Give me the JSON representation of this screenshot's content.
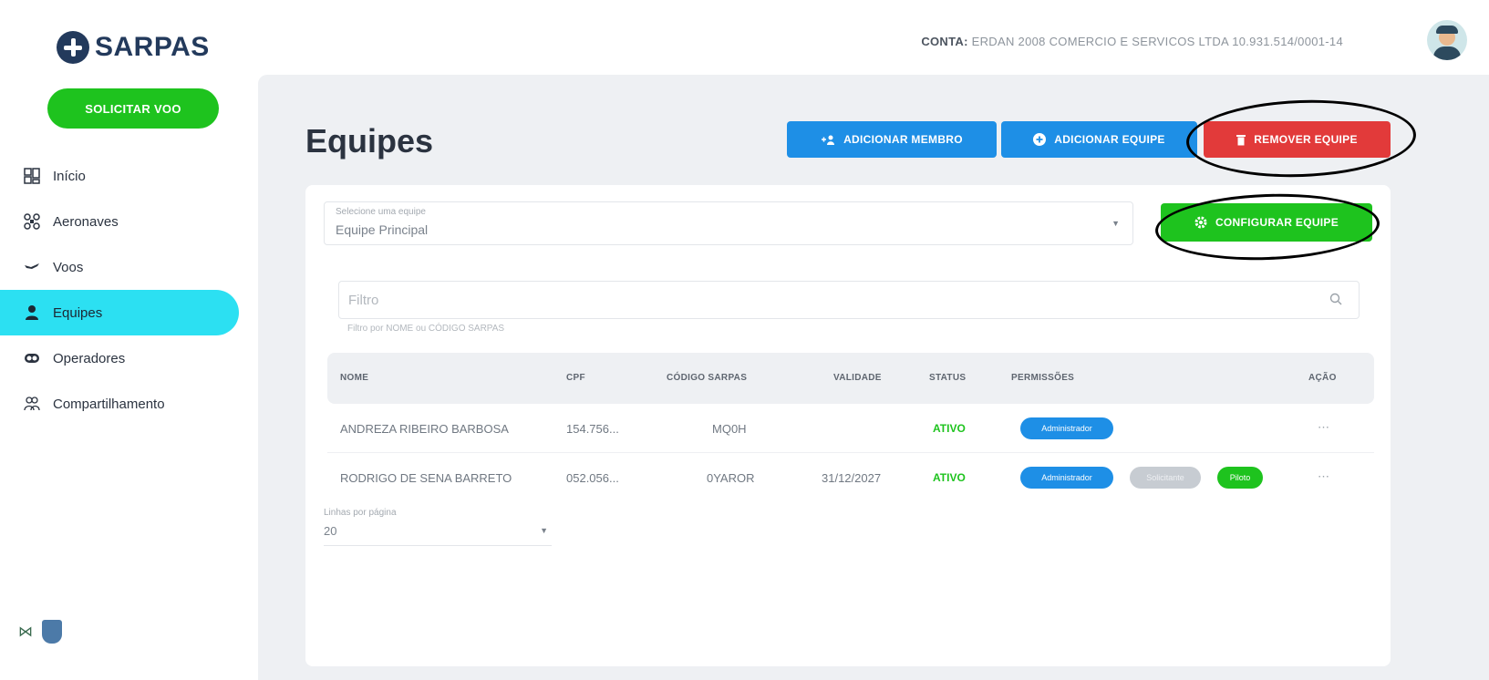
{
  "brand": {
    "name": "SARPAS"
  },
  "sidebar": {
    "cta": "SOLICITAR VOO",
    "items": [
      {
        "label": "Início",
        "icon": "dashboard-icon"
      },
      {
        "label": "Aeronaves",
        "icon": "drone-icon"
      },
      {
        "label": "Voos",
        "icon": "plane-icon"
      },
      {
        "label": "Equipes",
        "icon": "person-icon",
        "active": true
      },
      {
        "label": "Operadores",
        "icon": "id-card-icon"
      },
      {
        "label": "Compartilhamento",
        "icon": "users-icon"
      }
    ]
  },
  "header": {
    "account_label": "CONTA:",
    "account_value": "ERDAN 2008 COMERCIO E SERVICOS LTDA 10.931.514/0001-14"
  },
  "main": {
    "title": "Equipes",
    "buttons": {
      "add_member": "ADICIONAR MEMBRO",
      "add_team": "ADICIONAR EQUIPE",
      "remove_team": "REMOVER EQUIPE",
      "configure_team": "CONFIGURAR EQUIPE"
    },
    "team_select": {
      "label": "Selecione uma equipe",
      "value": "Equipe Principal"
    },
    "filter": {
      "placeholder": "Filtro",
      "helper": "Filtro por NOME ou CÓDIGO SARPAS"
    },
    "table": {
      "headers": [
        "NOME",
        "CPF",
        "CÓDIGO SARPAS",
        "VALIDADE",
        "STATUS",
        "PERMISSÕES",
        "AÇÃO"
      ],
      "rows": [
        {
          "nome": "ANDREZA RIBEIRO BARBOSA",
          "cpf": "154.756...",
          "codigo": "MQ0H",
          "validade": "",
          "status": "ATIVO",
          "badges": [
            "Administrador"
          ],
          "acao": "⋯"
        },
        {
          "nome": "RODRIGO DE SENA BARRETO",
          "cpf": "052.056...",
          "codigo": "0YAROR",
          "validade": "31/12/2027",
          "status": "ATIVO",
          "badges": [
            "Administrador",
            "Solicitante",
            "Piloto"
          ],
          "acao": "⋯"
        }
      ]
    },
    "per_page": {
      "label": "Linhas por página",
      "value": "20"
    }
  },
  "colors": {
    "primary_blue": "#1e8fe6",
    "danger_red": "#e23a3a",
    "success_green": "#1ec31e",
    "active_cyan": "#2ce0f2",
    "brand_navy": "#233a5c"
  }
}
